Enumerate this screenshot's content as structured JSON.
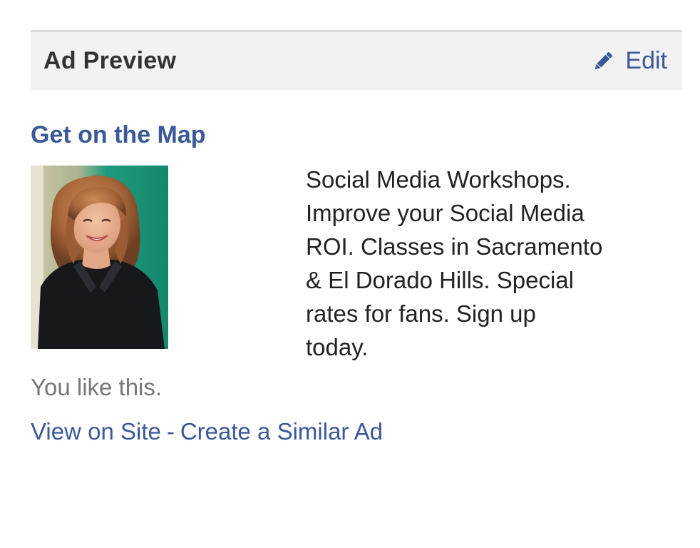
{
  "header": {
    "title": "Ad Preview",
    "edit_label": "Edit",
    "edit_icon": "pencil-icon"
  },
  "ad": {
    "title": "Get on the Map",
    "image_alt": "Woman with shoulder-length auburn hair wearing a black top, green background",
    "body_lines": [
      "Social Media Workshops.",
      "Improve your Social Media",
      "ROI. Classes in Sacramento",
      "& El Dorado Hills. Special",
      "rates for fans. Sign up",
      "today."
    ],
    "social_context": "You like this."
  },
  "footer": {
    "view_on_site": "View on Site",
    "separator": "-",
    "create_similar": "Create a Similar Ad"
  },
  "colors": {
    "link": "#3b5998",
    "header_bg": "#f2f2f2",
    "header_border": "#dcdcdc",
    "muted_text": "#777777"
  }
}
